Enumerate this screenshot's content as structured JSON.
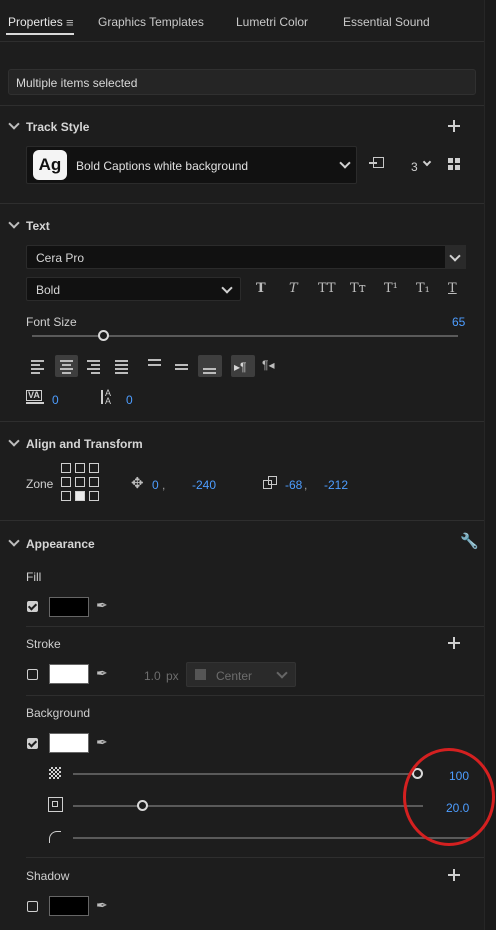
{
  "tabs": [
    {
      "label": "Properties"
    },
    {
      "label": "Graphics Templates"
    },
    {
      "label": "Lumetri Color"
    },
    {
      "label": "Essential Sound"
    }
  ],
  "selection_label": "Multiple items selected",
  "track_style": {
    "title": "Track Style",
    "badge": "Ag",
    "style_name": "Bold Captions white background",
    "count": "3"
  },
  "text": {
    "title": "Text",
    "font": "Cera Pro",
    "weight": "Bold",
    "style_buttons": [
      "T",
      "T",
      "TT",
      "Tт",
      "T¹",
      "T₁",
      "T"
    ],
    "font_size_label": "Font Size",
    "font_size_value": "65",
    "font_size_fraction": 0.17,
    "tracking_value": "0",
    "leading_value": "0"
  },
  "align_transform": {
    "title": "Align and Transform",
    "zone_label": "Zone",
    "position_x": "0",
    "position_y": "-240",
    "size_x": "-68",
    "size_y": "-212"
  },
  "appearance": {
    "title": "Appearance",
    "fill": {
      "label": "Fill",
      "checked": true,
      "color": "#000000"
    },
    "stroke": {
      "label": "Stroke",
      "checked": false,
      "color": "#ffffff",
      "width": "1.0",
      "unit": "px",
      "position": "Center"
    },
    "background": {
      "label": "Background",
      "checked": true,
      "color": "#ffffff",
      "opacity_value": "100",
      "opacity_fraction": 1.0,
      "size_value": "20.0",
      "size_fraction": 0.2
    },
    "shadow": {
      "label": "Shadow",
      "checked": false,
      "color": "#000000"
    }
  },
  "colors": {
    "accent_blue": "#4d9dff",
    "annotation_red": "#d42020"
  }
}
